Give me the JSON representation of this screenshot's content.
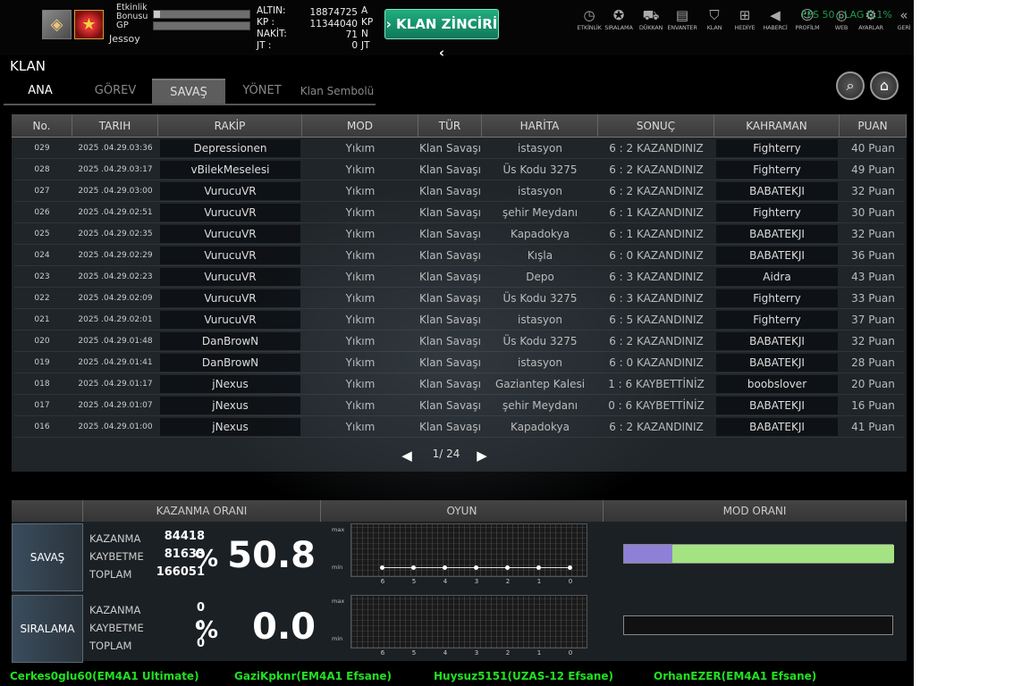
{
  "header": {
    "event_bonus_label": "Etkinlik Bonusu",
    "gp_label": "GP",
    "username": "Jessoy",
    "event_bonus_fill": 0.07,
    "gp_fill": 0.0,
    "currencies": [
      {
        "label": "ALTIN:",
        "value": "18874725",
        "unit": "A"
      },
      {
        "label": "KP :",
        "value": "11344040",
        "unit": "KP"
      },
      {
        "label": "NAKİT:",
        "value": "71",
        "unit": "N"
      },
      {
        "label": "JT :",
        "value": "0",
        "unit": "JT"
      }
    ],
    "clan_chain_label": "KLAN ZİNCİRİ",
    "ping": "FPS 50 | LAG 0.1%"
  },
  "menu": [
    {
      "label": "ETKİNLİK",
      "icon": "clock-icon",
      "glyph": "◷"
    },
    {
      "label": "SIRALAMA",
      "icon": "medal-icon",
      "glyph": "✪"
    },
    {
      "label": "DÜKKAN",
      "icon": "cart-icon",
      "glyph": "⛟"
    },
    {
      "label": "ENVANTER",
      "icon": "inventory-icon",
      "glyph": "▤"
    },
    {
      "label": "KLAN",
      "icon": "shield-icon",
      "glyph": "⛉"
    },
    {
      "label": "HEDİYE",
      "icon": "gift-icon",
      "glyph": "⊞"
    },
    {
      "label": "HABERCİ",
      "icon": "megaphone-icon",
      "glyph": "◀"
    },
    {
      "label": "PROFİLM",
      "icon": "profile-icon",
      "glyph": "☺"
    },
    {
      "label": "WEB",
      "icon": "web-icon",
      "glyph": "◎"
    },
    {
      "label": "AYARLAR",
      "icon": "gear-icon",
      "glyph": "⚙"
    },
    {
      "label": "GERİ",
      "icon": "back-icon",
      "glyph": "«"
    }
  ],
  "section_title": "KLAN",
  "tabs": [
    "ANA",
    "GÖREV",
    "SAVAŞ",
    "YÖNET",
    "Klan Sembolü"
  ],
  "table": {
    "columns": [
      "No.",
      "TARIH",
      "RAKİP",
      "MOD",
      "TÜR",
      "HARİTA",
      "SONUÇ",
      "KAHRAMAN",
      "PUAN"
    ],
    "rows": [
      {
        "no": "029",
        "date": "2025 .04.29.03:36",
        "rival": "Depressionen",
        "mode": "Yıkım",
        "type": "Klan Savaşı",
        "map": "istasyon",
        "result": "6 : 2 KAZANDINIZ",
        "hero": "Fighterry",
        "points": "40 Puan"
      },
      {
        "no": "028",
        "date": "2025 .04.29.03:17",
        "rival": "vBilekMeselesi",
        "mode": "Yıkım",
        "type": "Klan Savaşı",
        "map": "Üs Kodu 3275",
        "result": "6 : 2 KAZANDINIZ",
        "hero": "Fighterry",
        "points": "49 Puan"
      },
      {
        "no": "027",
        "date": "2025 .04.29.03:00",
        "rival": "VurucuVR",
        "mode": "Yıkım",
        "type": "Klan Savaşı",
        "map": "istasyon",
        "result": "6 : 2 KAZANDINIZ",
        "hero": "BABATEKJI",
        "points": "32 Puan"
      },
      {
        "no": "026",
        "date": "2025 .04.29.02:51",
        "rival": "VurucuVR",
        "mode": "Yıkım",
        "type": "Klan Savaşı",
        "map": "şehir Meydanı",
        "result": "6 : 1 KAZANDINIZ",
        "hero": "Fighterry",
        "points": "30 Puan"
      },
      {
        "no": "025",
        "date": "2025 .04.29.02:35",
        "rival": "VurucuVR",
        "mode": "Yıkım",
        "type": "Klan Savaşı",
        "map": "Kapadokya",
        "result": "6 : 1 KAZANDINIZ",
        "hero": "BABATEKJI",
        "points": "32 Puan"
      },
      {
        "no": "024",
        "date": "2025 .04.29.02:29",
        "rival": "VurucuVR",
        "mode": "Yıkım",
        "type": "Klan Savaşı",
        "map": "Kışla",
        "result": "6 : 0 KAZANDINIZ",
        "hero": "BABATEKJI",
        "points": "36 Puan"
      },
      {
        "no": "023",
        "date": "2025 .04.29.02:23",
        "rival": "VurucuVR",
        "mode": "Yıkım",
        "type": "Klan Savaşı",
        "map": "Depo",
        "result": "6 : 3 KAZANDINIZ",
        "hero": "Aidra",
        "points": "43 Puan"
      },
      {
        "no": "022",
        "date": "2025 .04.29.02:09",
        "rival": "VurucuVR",
        "mode": "Yıkım",
        "type": "Klan Savaşı",
        "map": "Üs Kodu 3275",
        "result": "6 : 3 KAZANDINIZ",
        "hero": "Fighterry",
        "points": "33 Puan"
      },
      {
        "no": "021",
        "date": "2025 .04.29.02:01",
        "rival": "VurucuVR",
        "mode": "Yıkım",
        "type": "Klan Savaşı",
        "map": "istasyon",
        "result": "6 : 5 KAZANDINIZ",
        "hero": "Fighterry",
        "points": "37 Puan"
      },
      {
        "no": "020",
        "date": "2025 .04.29.01:48",
        "rival": "DanBrowN",
        "mode": "Yıkım",
        "type": "Klan Savaşı",
        "map": "Üs Kodu 3275",
        "result": "6 : 2 KAZANDINIZ",
        "hero": "BABATEKJI",
        "points": "32 Puan"
      },
      {
        "no": "019",
        "date": "2025 .04.29.01:41",
        "rival": "DanBrowN",
        "mode": "Yıkım",
        "type": "Klan Savaşı",
        "map": "istasyon",
        "result": "6 : 0 KAZANDINIZ",
        "hero": "BABATEKJI",
        "points": "28 Puan"
      },
      {
        "no": "018",
        "date": "2025 .04.29.01:17",
        "rival": "jNexus",
        "mode": "Yıkım",
        "type": "Klan Savaşı",
        "map": "Gaziantep Kalesi",
        "result": "1 : 6 KAYBETTİNİZ",
        "hero": "boobslover",
        "points": "20 Puan"
      },
      {
        "no": "017",
        "date": "2025 .04.29.01:07",
        "rival": "jNexus",
        "mode": "Yıkım",
        "type": "Klan Savaşı",
        "map": "şehir Meydanı",
        "result": "0 : 6 KAYBETTİNİZ",
        "hero": "BABATEKJI",
        "points": "16 Puan"
      },
      {
        "no": "016",
        "date": "2025 .04.29.01:00",
        "rival": "jNexus",
        "mode": "Yıkım",
        "type": "Klan Savaşı",
        "map": "Kapadokya",
        "result": "6 : 2 KAZANDINIZ",
        "hero": "BABATEKJI",
        "points": "41 Puan"
      }
    ],
    "page": "1/ 24"
  },
  "stats": {
    "headers": [
      "KAZANMA ORANI",
      "OYUN",
      "MOD ORANI"
    ],
    "graph_max": "max",
    "graph_min": "min",
    "graph_ticks": [
      "6",
      "5",
      "4",
      "3",
      "2",
      "1",
      "0"
    ],
    "rows": [
      {
        "label": "SAVAŞ",
        "win_label": "KAZANMA",
        "win": "84418",
        "loss_label": "KAYBETME",
        "loss": "81633",
        "total_label": "TOPLAM",
        "total": "166051",
        "pct_sign": "%",
        "rate": "50.8",
        "mode_ratio": [
          0.18,
          0.82
        ]
      },
      {
        "label": "SIRALAMA",
        "win_label": "KAZANMA",
        "win": "0",
        "loss_label": "KAYBETME",
        "loss": "0",
        "total_label": "TOPLAM",
        "total": "0",
        "pct_sign": "%",
        "rate": "0.0",
        "mode_ratio": [
          0,
          0
        ]
      }
    ]
  },
  "players": [
    "Cerkes0glu60(EM4A1 Ultimate)",
    "GaziKpknr(EM4A1 Efsane)",
    "Huysuz5151(UZAS-12 Efsane)",
    "OrhanEZER(EM4A1 Efsane)"
  ]
}
